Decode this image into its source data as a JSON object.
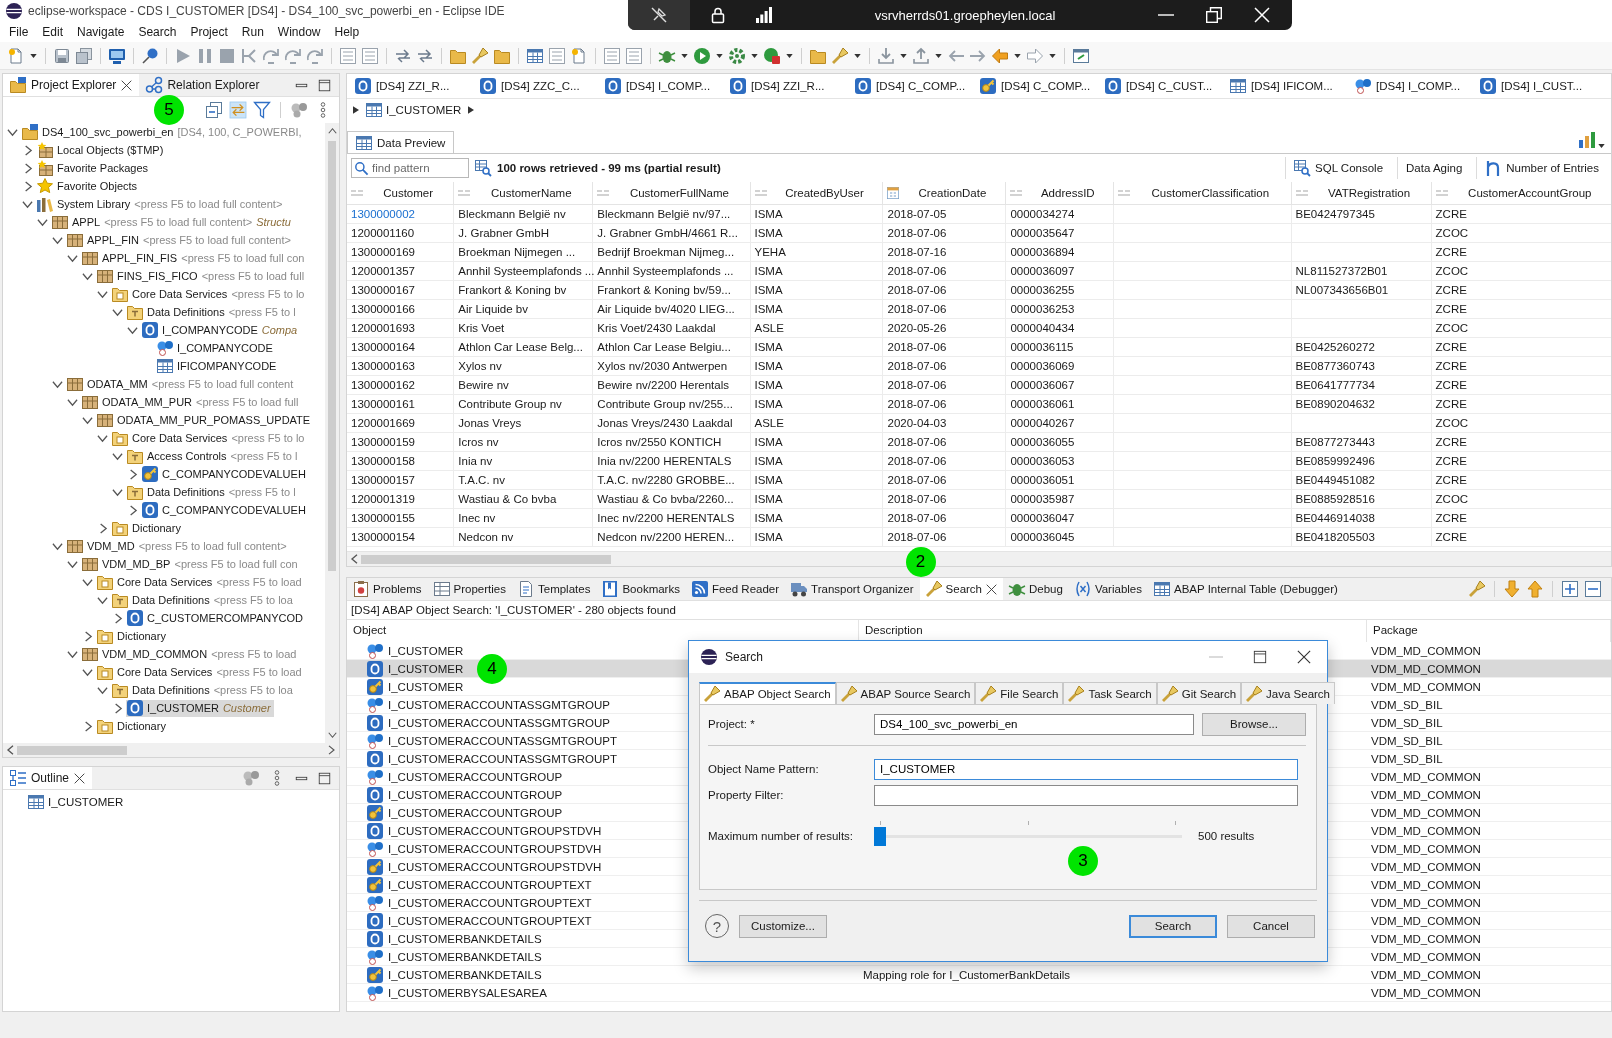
{
  "window": {
    "title": "eclipse-workspace - CDS I_CUSTOMER [DS4] - DS4_100_svc_powerbi_en - Eclipse IDE"
  },
  "remote_bar": {
    "host": "vsrvherrds01.groepheylen.local"
  },
  "menu": [
    "File",
    "Edit",
    "Navigate",
    "Search",
    "Project",
    "Run",
    "Window",
    "Help"
  ],
  "project_explorer": {
    "tabs": [
      {
        "label": "Project Explorer",
        "selected": true
      },
      {
        "label": "Relation Explorer",
        "selected": false
      }
    ],
    "link_toggle": {
      "on": true
    },
    "callout": "5",
    "tree": [
      {
        "label": "DS4_100_svc_powerbi_en",
        "hint": "[DS4, 100, C_POWERBI,",
        "kind": "project",
        "expanded": true,
        "selected": false,
        "children": [
          {
            "label": "Local Objects ($TMP)",
            "kind": "local_package",
            "expanded": false,
            "selected": false
          },
          {
            "label": "Favorite Packages",
            "kind": "favorite_packages",
            "expanded": false,
            "selected": false
          },
          {
            "label": "Favorite Objects",
            "kind": "favorite_objects",
            "expanded": false,
            "selected": false
          },
          {
            "label": "System Library",
            "hint": "<press F5 to load full content>",
            "kind": "library",
            "expanded": true,
            "selected": false,
            "children": [
              {
                "label": "APPL",
                "hint": "<press F5 to load full content>",
                "detail": "Structu",
                "kind": "package",
                "expanded": true,
                "selected": false,
                "children": [
                  {
                    "label": "APPL_FIN",
                    "hint": "<press F5 to load full content>",
                    "kind": "package",
                    "expanded": true,
                    "selected": false,
                    "children": [
                      {
                        "label": "APPL_FIN_FIS",
                        "hint": "<press F5 to load full con",
                        "kind": "package",
                        "expanded": true,
                        "selected": false,
                        "children": [
                          {
                            "label": "FINS_FIS_FICO",
                            "hint": "<press F5 to load full",
                            "kind": "package",
                            "expanded": true,
                            "selected": false,
                            "children": [
                              {
                                "label": "Core Data Services",
                                "hint": "<press F5 to lo",
                                "kind": "folder",
                                "expanded": true,
                                "selected": false,
                                "children": [
                                  {
                                    "label": "Data Definitions",
                                    "hint": "<press F5 to l",
                                    "kind": "type_folder",
                                    "expanded": true,
                                    "selected": false,
                                    "children": [
                                      {
                                        "label": "I_COMPANYCODE",
                                        "detail": "Compa",
                                        "kind": "definition",
                                        "expanded": true,
                                        "selected": false,
                                        "children": [
                                          {
                                            "label": "I_COMPANYCODE",
                                            "kind": "entity",
                                            "selected": false
                                          },
                                          {
                                            "label": "IFICOMPANYCODE",
                                            "kind": "table",
                                            "selected": false
                                          }
                                        ]
                                      }
                                    ]
                                  }
                                ]
                              }
                            ]
                          }
                        ]
                      }
                    ]
                  },
                  {
                    "label": "ODATA_MM",
                    "hint": "<press F5 to load full content",
                    "kind": "package",
                    "expanded": true,
                    "selected": false,
                    "children": [
                      {
                        "label": "ODATA_MM_PUR",
                        "hint": "<press F5 to load full",
                        "kind": "package",
                        "expanded": true,
                        "selected": false,
                        "children": [
                          {
                            "label": "ODATA_MM_PUR_POMASS_UPDATE",
                            "kind": "package",
                            "expanded": true,
                            "selected": false,
                            "children": [
                              {
                                "label": "Core Data Services",
                                "hint": "<press F5 to lo",
                                "kind": "folder",
                                "expanded": true,
                                "selected": false,
                                "children": [
                                  {
                                    "label": "Access Controls",
                                    "hint": "<press F5 to l",
                                    "kind": "type_folder",
                                    "expanded": true,
                                    "selected": false,
                                    "children": [
                                      {
                                        "label": "C_COMPANYCODEVALUEH",
                                        "kind": "access_control",
                                        "expanded": false,
                                        "selected": false
                                      }
                                    ]
                                  },
                                  {
                                    "label": "Data Definitions",
                                    "hint": "<press F5 to l",
                                    "kind": "type_folder",
                                    "expanded": true,
                                    "selected": false,
                                    "children": [
                                      {
                                        "label": "C_COMPANYCODEVALUEH",
                                        "kind": "definition",
                                        "expanded": false,
                                        "selected": false
                                      }
                                    ]
                                  }
                                ]
                              },
                              {
                                "label": "Dictionary",
                                "kind": "folder",
                                "expanded": false,
                                "selected": false
                              }
                            ]
                          }
                        ]
                      }
                    ]
                  },
                  {
                    "label": "VDM_MD",
                    "hint": "<press F5 to load full content>",
                    "kind": "package",
                    "expanded": true,
                    "selected": false,
                    "children": [
                      {
                        "label": "VDM_MD_BP",
                        "hint": "<press F5 to load full con",
                        "kind": "package",
                        "expanded": true,
                        "selected": false,
                        "children": [
                          {
                            "label": "Core Data Services",
                            "hint": "<press F5 to load",
                            "kind": "folder",
                            "expanded": true,
                            "selected": false,
                            "children": [
                              {
                                "label": "Data Definitions",
                                "hint": "<press F5 to loa",
                                "kind": "type_folder",
                                "expanded": true,
                                "selected": false,
                                "children": [
                                  {
                                    "label": "C_CUSTOMERCOMPANYCOD",
                                    "kind": "definition",
                                    "expanded": false,
                                    "selected": false
                                  }
                                ]
                              }
                            ]
                          },
                          {
                            "label": "Dictionary",
                            "kind": "folder",
                            "expanded": false,
                            "selected": false
                          }
                        ]
                      },
                      {
                        "label": "VDM_MD_COMMON",
                        "hint": "<press F5 to load",
                        "kind": "package",
                        "expanded": true,
                        "selected": false,
                        "children": [
                          {
                            "label": "Core Data Services",
                            "hint": "<press F5 to load",
                            "kind": "folder",
                            "expanded": true,
                            "selected": false,
                            "children": [
                              {
                                "label": "Data Definitions",
                                "hint": "<press F5 to loa",
                                "kind": "type_folder",
                                "expanded": true,
                                "selected": false,
                                "children": [
                                  {
                                    "label": "I_CUSTOMER",
                                    "detail": "Customer",
                                    "kind": "definition",
                                    "expanded": false,
                                    "selected": true
                                  }
                                ]
                              }
                            ]
                          },
                          {
                            "label": "Dictionary",
                            "kind": "folder",
                            "expanded": false,
                            "selected": false
                          }
                        ]
                      }
                    ]
                  }
                ]
              }
            ]
          }
        ]
      }
    ]
  },
  "outline": {
    "tab": "Outline",
    "items": [
      {
        "label": "I_CUSTOMER",
        "selected": false
      }
    ]
  },
  "editor": {
    "tabs": [
      {
        "label": "[DS4] ZZI_R...",
        "kind": "definition",
        "selected": false
      },
      {
        "label": "[DS4] ZZC_C...",
        "kind": "definition",
        "selected": false
      },
      {
        "label": "[DS4] I_COMP...",
        "kind": "definition",
        "selected": false
      },
      {
        "label": "[DS4] ZZI_R...",
        "kind": "definition",
        "selected": false
      },
      {
        "label": "[DS4] C_COMP...",
        "kind": "definition",
        "selected": false
      },
      {
        "label": "[DS4] C_COMP...",
        "kind": "access_control",
        "selected": false
      },
      {
        "label": "[DS4] C_CUST...",
        "kind": "definition",
        "selected": false
      },
      {
        "label": "[DS4] IFICOM...",
        "kind": "table",
        "selected": false
      },
      {
        "label": "[DS4] I_COMP...",
        "kind": "entity",
        "selected": false
      },
      {
        "label": "[DS4] I_CUST...",
        "kind": "definition",
        "selected": false
      }
    ],
    "breadcrumb": "I_CUSTOMER",
    "view_tab": "Data Preview",
    "filter": {
      "placeholder": "find pattern"
    },
    "result_info": "100 rows retrieved - 99 ms (partial result)",
    "actions": [
      "SQL Console",
      "Data Aging",
      "Number of Entries"
    ],
    "table": {
      "columns": [
        {
          "label": "Customer",
          "kind": "text"
        },
        {
          "label": "CustomerName",
          "kind": "text"
        },
        {
          "label": "CustomerFullName",
          "kind": "text"
        },
        {
          "label": "CreatedByUser",
          "kind": "text"
        },
        {
          "label": "CreationDate",
          "kind": "date"
        },
        {
          "label": "AddressID",
          "kind": "text"
        },
        {
          "label": "CustomerClassification",
          "kind": "text"
        },
        {
          "label": "VATRegistration",
          "kind": "text"
        },
        {
          "label": "CustomerAccountGroup",
          "kind": "text"
        }
      ],
      "rows": [
        {
          "cells": [
            "1300000002",
            "Bleckmann België nv",
            "Bleckmann België nv/97...",
            "ISMA",
            "2018-07-05",
            "0000034274",
            null,
            "BE0424797345",
            "ZCRE"
          ],
          "hover": true
        },
        {
          "cells": [
            "1200001160",
            "J. Grabner GmbH",
            "J. Grabner GmbH/4661 R...",
            "ISMA",
            "2018-07-06",
            "0000035647",
            null,
            null,
            "ZCOC"
          ],
          "hover": false
        },
        {
          "cells": [
            "1300000169",
            "Broekman Nijmegen ...",
            "Bedrijf Broekman Nijmeg...",
            "YEHA",
            "2018-07-16",
            "0000036894",
            null,
            null,
            "ZCRE"
          ],
          "hover": false
        },
        {
          "cells": [
            "1200001357",
            "Annhil Systeemplafonds ...",
            "Annhil Systeemplafonds ...",
            "ISMA",
            "2018-07-06",
            "0000036097",
            null,
            "NL811527372B01",
            "ZCOC"
          ],
          "hover": false
        },
        {
          "cells": [
            "1300000167",
            "Frankort & Koning bv",
            "Frankort & Koning bv/59...",
            "ISMA",
            "2018-07-06",
            "0000036255",
            null,
            "NL007343656B01",
            "ZCRE"
          ],
          "hover": false
        },
        {
          "cells": [
            "1300000166",
            "Air Liquide bv",
            "Air Liquide bv/4020 LIEG...",
            "ISMA",
            "2018-07-06",
            "0000036253",
            null,
            null,
            "ZCRE"
          ],
          "hover": false
        },
        {
          "cells": [
            "1200001693",
            "Kris Voet",
            "Kris Voet/2430 Laakdal",
            "ASLE",
            "2020-05-26",
            "0000040434",
            null,
            null,
            "ZCOC"
          ],
          "hover": false
        },
        {
          "cells": [
            "1300000164",
            "Athlon Car Lease Belg...",
            "Athlon Car Lease Belgiu...",
            "ISMA",
            "2018-07-06",
            "0000036115",
            null,
            "BE0425260272",
            "ZCRE"
          ],
          "hover": false
        },
        {
          "cells": [
            "1300000163",
            "Xylos nv",
            "Xylos nv/2030 Antwerpen",
            "ISMA",
            "2018-07-06",
            "0000036069",
            null,
            "BE0877360743",
            "ZCRE"
          ],
          "hover": false
        },
        {
          "cells": [
            "1300000162",
            "Bewire nv",
            "Bewire nv/2200 Herentals",
            "ISMA",
            "2018-07-06",
            "0000036067",
            null,
            "BE0641777734",
            "ZCRE"
          ],
          "hover": false
        },
        {
          "cells": [
            "1300000161",
            "Contribute Group nv",
            "Contribute Group nv/255...",
            "ISMA",
            "2018-07-06",
            "0000036061",
            null,
            "BE0890204632",
            "ZCRE"
          ],
          "hover": false
        },
        {
          "cells": [
            "1200001669",
            "Jonas Vreys",
            "Jonas Vreys/2430 Laakdal",
            "ASLE",
            "2020-04-03",
            "0000040267",
            null,
            null,
            "ZCOC"
          ],
          "hover": false
        },
        {
          "cells": [
            "1300000159",
            "Icros nv",
            "Icros nv/2550 KONTICH",
            "ISMA",
            "2018-07-06",
            "0000036055",
            null,
            "BE0877273443",
            "ZCRE"
          ],
          "hover": false
        },
        {
          "cells": [
            "1300000158",
            "Inia nv",
            "Inia nv/2200 HERENTALS",
            "ISMA",
            "2018-07-06",
            "0000036053",
            null,
            "BE0859992496",
            "ZCRE"
          ],
          "hover": false
        },
        {
          "cells": [
            "1300000157",
            "T.A.C. nv",
            "T.A.C. nv/2280 GROBBE...",
            "ISMA",
            "2018-07-06",
            "0000036051",
            null,
            "BE0449451082",
            "ZCRE"
          ],
          "hover": false
        },
        {
          "cells": [
            "1200001319",
            "Wastiau & Co bvba",
            "Wastiau & Co bvba/2260...",
            "ISMA",
            "2018-07-06",
            "0000035987",
            null,
            "BE0885928516",
            "ZCOC"
          ],
          "hover": false
        },
        {
          "cells": [
            "1300000155",
            "Inec nv",
            "Inec nv/2200 HERENTALS",
            "ISMA",
            "2018-07-06",
            "0000036047",
            null,
            "BE0446914038",
            "ZCRE"
          ],
          "hover": false
        },
        {
          "cells": [
            "1300000154",
            "Nedcon nv",
            "Nedcon nv/2200 HEREN...",
            "ISMA",
            "2018-07-06",
            "0000036045",
            null,
            "BE0418205503",
            "ZCRE"
          ],
          "hover": false
        }
      ]
    }
  },
  "bottom_panel": {
    "tabs": [
      {
        "label": "Problems",
        "selected": false
      },
      {
        "label": "Properties",
        "selected": false
      },
      {
        "label": "Templates",
        "selected": false
      },
      {
        "label": "Bookmarks",
        "selected": false
      },
      {
        "label": "Feed Reader",
        "selected": false
      },
      {
        "label": "Transport Organizer",
        "selected": false
      },
      {
        "label": "Search",
        "selected": true,
        "callout": "2"
      },
      {
        "label": "Debug",
        "selected": false
      },
      {
        "label": "Variables",
        "selected": false
      },
      {
        "label": "ABAP Internal Table (Debugger)",
        "selected": false
      }
    ],
    "summary": "[DS4] ABAP Object Search: 'I_CUSTOMER' - 280 objects found",
    "columns": [
      "Object",
      "Description",
      "Package"
    ],
    "rows": [
      {
        "object": "I_CUSTOMER",
        "kind": "entity",
        "package": "VDM_MD_COMMON",
        "selected": false
      },
      {
        "object": "I_CUSTOMER",
        "kind": "definition",
        "package": "VDM_MD_COMMON",
        "selected": true,
        "callout": "4"
      },
      {
        "object": "I_CUSTOMER",
        "kind": "access_control",
        "package": "VDM_MD_COMMON",
        "selected": false
      },
      {
        "object": "I_CUSTOMERACCOUNTASSGMTGROUP",
        "kind": "entity",
        "package": "VDM_SD_BIL",
        "selected": false
      },
      {
        "object": "I_CUSTOMERACCOUNTASSGMTGROUP",
        "kind": "definition",
        "package": "VDM_SD_BIL",
        "selected": false
      },
      {
        "object": "I_CUSTOMERACCOUNTASSGMTGROUPT",
        "kind": "entity",
        "package": "VDM_SD_BIL",
        "selected": false
      },
      {
        "object": "I_CUSTOMERACCOUNTASSGMTGROUPT",
        "kind": "definition",
        "package": "VDM_SD_BIL",
        "selected": false
      },
      {
        "object": "I_CUSTOMERACCOUNTGROUP",
        "kind": "entity",
        "package": "VDM_MD_COMMON",
        "selected": false
      },
      {
        "object": "I_CUSTOMERACCOUNTGROUP",
        "kind": "definition",
        "package": "VDM_MD_COMMON",
        "selected": false
      },
      {
        "object": "I_CUSTOMERACCOUNTGROUP",
        "kind": "access_control",
        "package": "VDM_MD_COMMON",
        "selected": false
      },
      {
        "object": "I_CUSTOMERACCOUNTGROUPSTDVH",
        "kind": "definition",
        "package": "VDM_MD_COMMON",
        "selected": false
      },
      {
        "object": "I_CUSTOMERACCOUNTGROUPSTDVH",
        "kind": "entity",
        "package": "VDM_MD_COMMON",
        "selected": false
      },
      {
        "object": "I_CUSTOMERACCOUNTGROUPSTDVH",
        "kind": "access_control",
        "package": "VDM_MD_COMMON",
        "selected": false
      },
      {
        "object": "I_CUSTOMERACCOUNTGROUPTEXT",
        "kind": "access_control",
        "package": "VDM_MD_COMMON",
        "selected": false
      },
      {
        "object": "I_CUSTOMERACCOUNTGROUPTEXT",
        "kind": "entity",
        "package": "VDM_MD_COMMON",
        "selected": false
      },
      {
        "object": "I_CUSTOMERACCOUNTGROUPTEXT",
        "kind": "definition",
        "package": "VDM_MD_COMMON",
        "selected": false
      },
      {
        "object": "I_CUSTOMERBANKDETAILS",
        "kind": "definition",
        "package": "VDM_MD_COMMON",
        "selected": false
      },
      {
        "object": "I_CUSTOMERBANKDETAILS",
        "kind": "entity",
        "package": "VDM_MD_COMMON",
        "selected": false
      },
      {
        "object": "I_CUSTOMERBANKDETAILS",
        "kind": "access_control",
        "description": "Mapping role for I_CustomerBankDetails",
        "package": "VDM_MD_COMMON",
        "selected": false
      },
      {
        "object": "I_CUSTOMERBYSALESAREA",
        "kind": "entity",
        "package": "VDM_MD_COMMON",
        "selected": false
      }
    ]
  },
  "search_dialog": {
    "title": "Search",
    "tabs": [
      {
        "label": "ABAP Object Search",
        "selected": true
      },
      {
        "label": "ABAP Source Search",
        "selected": false
      },
      {
        "label": "File Search",
        "selected": false
      },
      {
        "label": "Task Search",
        "selected": false
      },
      {
        "label": "Git Search",
        "selected": false
      },
      {
        "label": "Java Search",
        "selected": false
      }
    ],
    "fields": [
      {
        "label": "Project: *",
        "value": "DS4_100_svc_powerbi_en",
        "focused": false,
        "button": "Browse..."
      },
      {
        "label": "Object Name Pattern:",
        "value": "I_CUSTOMER",
        "focused": true
      },
      {
        "label": "Property Filter:",
        "focused": false
      }
    ],
    "max_results": {
      "label": "Maximum number of results:",
      "level": 0,
      "reading": "500 results",
      "callout": "3"
    },
    "help": "?",
    "customize_button": "Customize...",
    "buttons": [
      {
        "label": "Search",
        "default": true
      },
      {
        "label": "Cancel",
        "default": false
      }
    ]
  }
}
